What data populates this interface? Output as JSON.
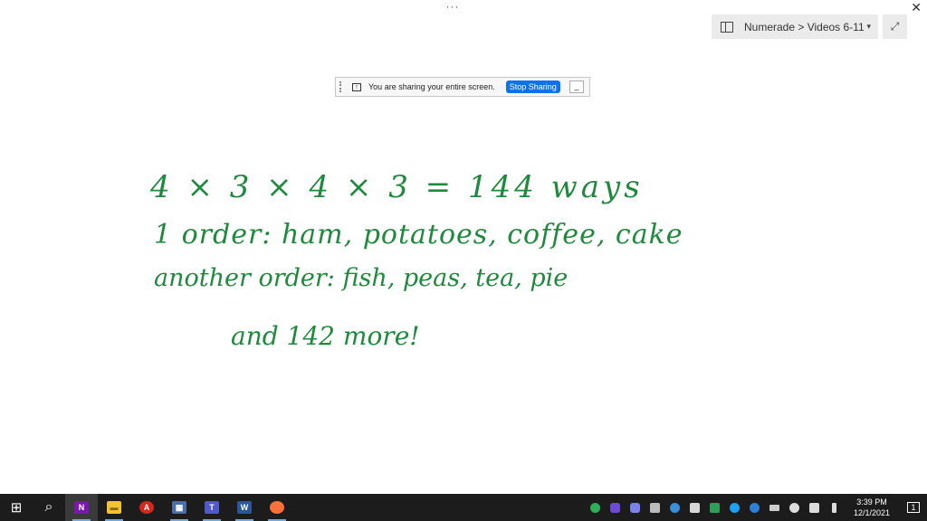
{
  "window": {
    "top_menu_glyph": "···",
    "close_glyph": "✕",
    "notebook_picker": {
      "label": "Numerade > Videos 6-11",
      "icon": "notebook-icon",
      "caret": "▾"
    },
    "expand_glyph": "⤢"
  },
  "share_bar": {
    "message": "You are sharing your entire screen.",
    "stop_label": "Stop Sharing",
    "minimize_glyph": "_"
  },
  "handwriting": {
    "line1": "4 × 3 × 4 × 3  =  144 ways",
    "line2": "1 order:  ham, potatoes, coffee, cake",
    "line3": "another order:   fish, peas, tea, pie",
    "line4": "and 142 more!",
    "ink_color": "#1e8a3b"
  },
  "taskbar": {
    "apps": [
      {
        "name": "windows-start",
        "glyph": "⊞"
      },
      {
        "name": "search",
        "glyph": "⌕"
      },
      {
        "name": "onenote",
        "glyph": "N"
      },
      {
        "name": "file-explorer",
        "glyph": "▬"
      },
      {
        "name": "acrobat",
        "glyph": "A"
      },
      {
        "name": "screen-recorder",
        "glyph": "▦"
      },
      {
        "name": "teams",
        "glyph": "T"
      },
      {
        "name": "word",
        "glyph": "W"
      },
      {
        "name": "firefox",
        "glyph": "●"
      }
    ],
    "clock_time": "3:39 PM",
    "clock_date": "12/1/2021",
    "notification_count": "1"
  }
}
